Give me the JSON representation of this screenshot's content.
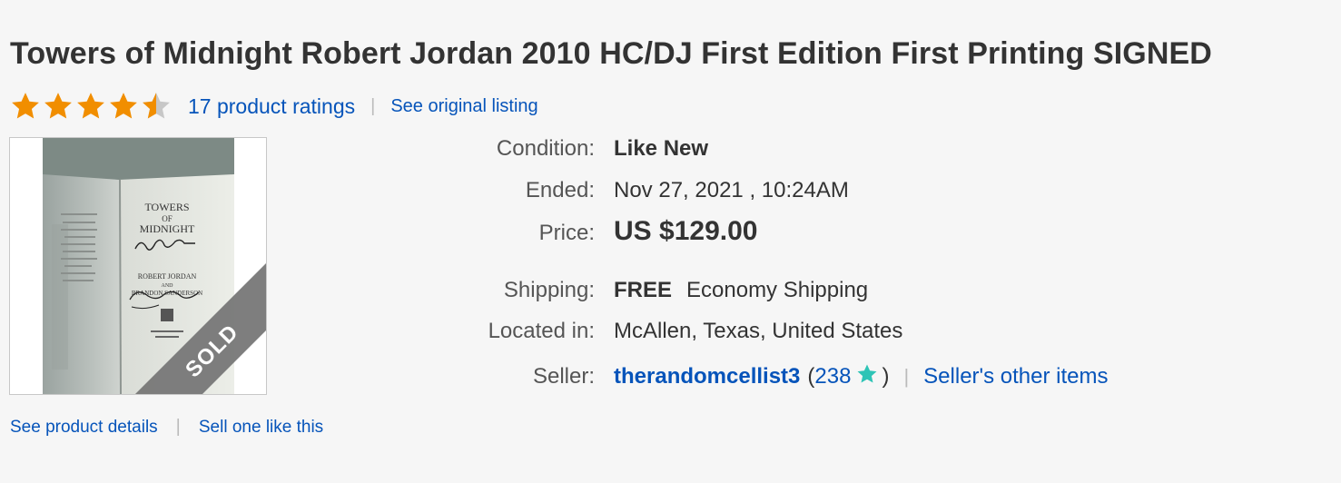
{
  "listing": {
    "title": "Towers of Midnight Robert Jordan 2010 HC/DJ First Edition First Printing SIGNED",
    "rating_value": 4.5,
    "rating_max": 5,
    "ratings_link": "17 product ratings",
    "separator": "|",
    "original_listing_link": "See original listing"
  },
  "image": {
    "sold_badge": "SOLD",
    "book_title_line1": "TOWERS",
    "book_title_line2": "OF",
    "book_title_line3": "MIDNIGHT",
    "book_author_line": "ROBERT JORDAN",
    "book_and": "AND",
    "book_coauthor_line": "BRANDON SANDERSON"
  },
  "links": {
    "product_details": "See product details",
    "sell_one": "Sell one like this"
  },
  "details": {
    "condition_label": "Condition:",
    "condition_value": "Like New",
    "ended_label": "Ended:",
    "ended_value": "Nov 27, 2021 , 10:24AM",
    "price_label": "Price:",
    "price_value": "US $129.00",
    "shipping_label": "Shipping:",
    "shipping_free": "FREE",
    "shipping_method": "Economy Shipping",
    "located_label": "Located in:",
    "located_value": "McAllen, Texas, United States",
    "seller_label": "Seller:",
    "seller_name": "therandomcellist3",
    "seller_feedback_open": "(",
    "seller_feedback": "238",
    "seller_feedback_close": ")",
    "seller_other_items": "Seller's other items"
  },
  "colors": {
    "link": "#0654ba",
    "star": "#f18e00",
    "star_empty": "#c7c7c7",
    "feedback_star": "#2ec4b6",
    "sold_band": "#777777"
  },
  "icons": {
    "rating": "star-icon",
    "feedback": "feedback-star-icon"
  }
}
